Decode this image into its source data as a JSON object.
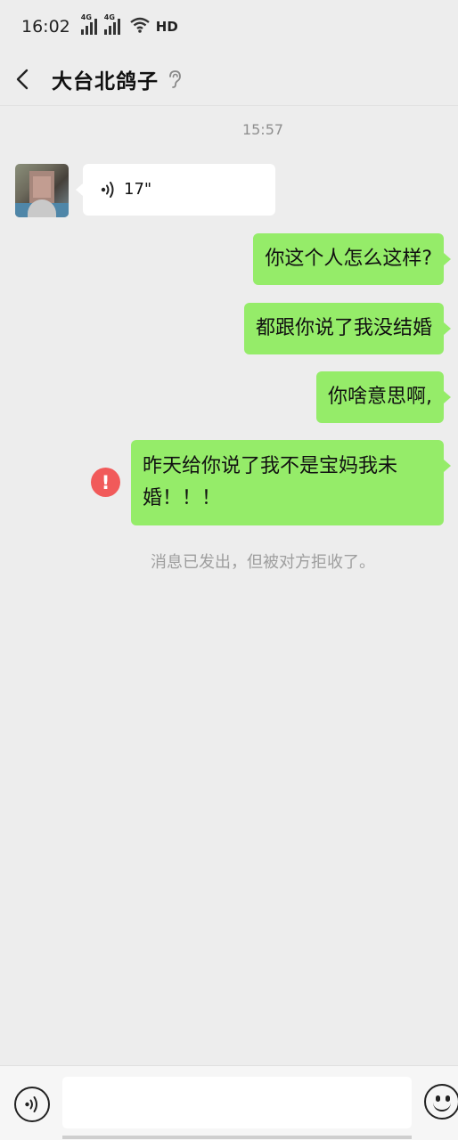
{
  "status_bar": {
    "time": "16:02",
    "signal1": "4G",
    "signal2": "4G",
    "hd": "HD"
  },
  "header": {
    "title": "大台北鸽子",
    "back_icon": "chevron-left-icon",
    "ear_icon": "ear-icon"
  },
  "chat": {
    "timestamp": "15:57",
    "voice_message": {
      "duration": "17\"",
      "icon": "voice-wave-icon"
    },
    "outgoing": [
      {
        "text": "你这个人怎么这样?"
      },
      {
        "text": "都跟你说了我没结婚"
      },
      {
        "text": "你啥意思啊,"
      },
      {
        "text": "昨天给你说了我不是宝妈我未婚！！！"
      }
    ],
    "failed_indicator": "!",
    "system_note": "消息已发出，但被对方拒收了。"
  },
  "input_bar": {
    "voice_toggle_icon": "voice-icon",
    "input_value": "",
    "emoji_icon": "emoji-icon"
  },
  "colors": {
    "background": "#ededed",
    "outgoing_bubble": "#95ec69",
    "incoming_bubble": "#ffffff",
    "error": "#f15a5a"
  }
}
